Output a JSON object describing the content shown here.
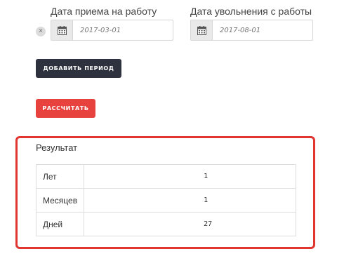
{
  "hire_date": {
    "label": "Дата приема на работу",
    "placeholder": "2017-03-01"
  },
  "dismissal_date": {
    "label": "Дата увольнения с работы",
    "placeholder": "2017-08-01"
  },
  "buttons": {
    "remove": "×",
    "add_period": "ДОБАВИТЬ ПЕРИОД",
    "calculate": "РАССЧИТАТЬ"
  },
  "result": {
    "title": "Результат",
    "rows": [
      {
        "label": "Лет",
        "value": "1"
      },
      {
        "label": "Месяцев",
        "value": "1"
      },
      {
        "label": "Дней",
        "value": "27"
      }
    ]
  },
  "colors": {
    "dark_button": "#2d323e",
    "red_button": "#e8423f",
    "result_border": "#e13530"
  },
  "icons": {
    "calendar": "calendar-icon",
    "remove": "close-icon"
  }
}
